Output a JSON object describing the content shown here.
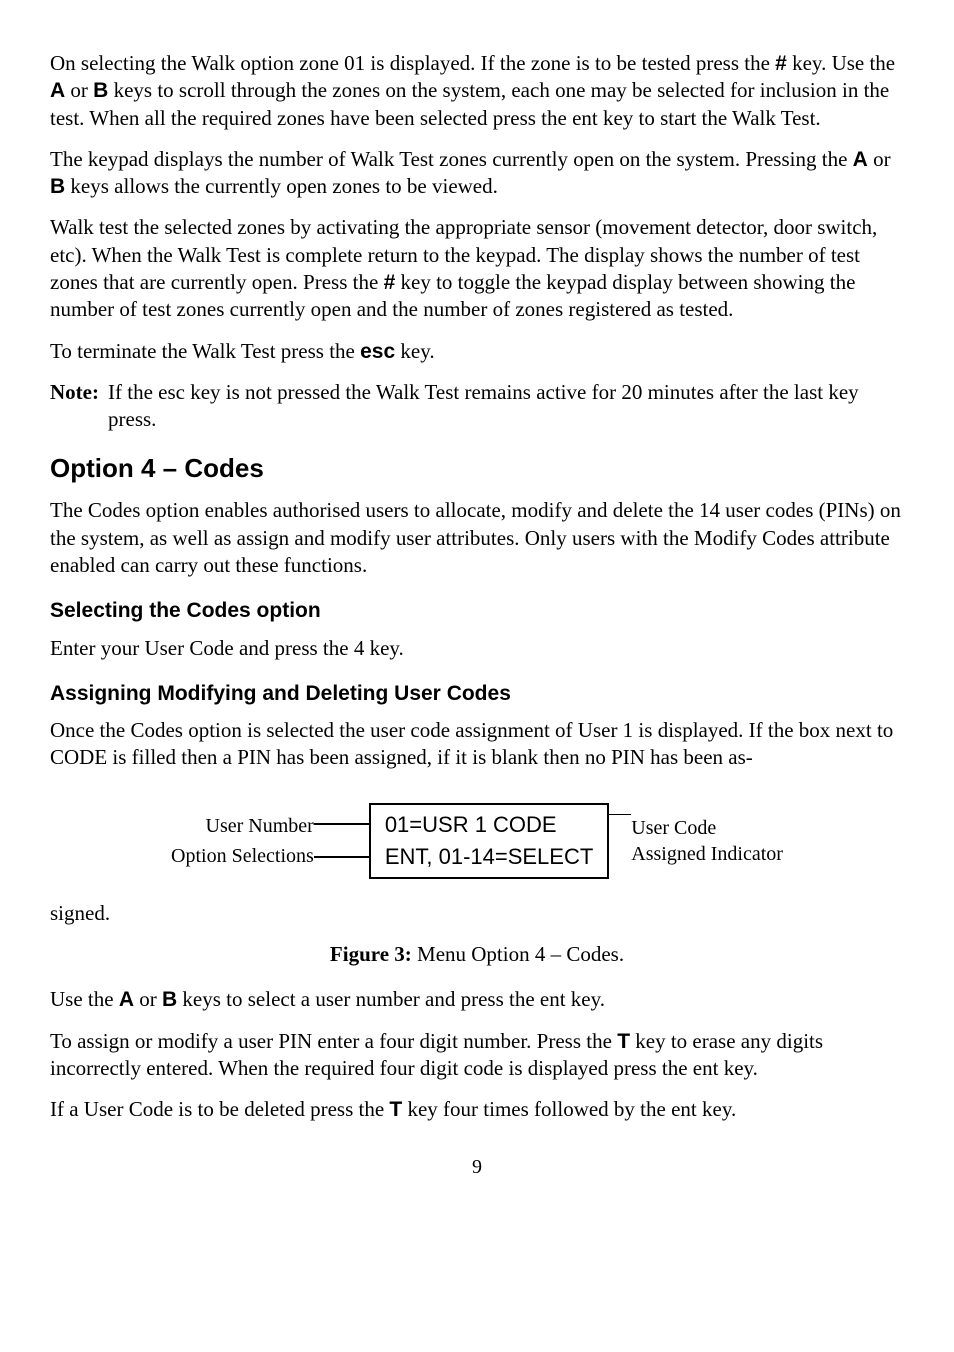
{
  "p1_a": "On selecting the Walk option zone 01 is displayed. If the zone is to be tested press the ",
  "p1_hash": "#",
  "p1_b": " key. Use the ",
  "p1_A": "A",
  "p1_c": " or ",
  "p1_B": "B",
  "p1_d": " keys to scroll through the zones on the system, each one may be selected for inclusion in the test. When all the required zones have been selected press the ent key to start the Walk Test.",
  "p2_a": "The keypad displays the number of Walk Test zones currently open on the system. Pressing the ",
  "p2_A": "A",
  "p2_b": " or ",
  "p2_B": "B",
  "p2_c": " keys allows the currently open zones to be viewed.",
  "p3_a": "Walk test the selected zones by activating the appropriate sensor (movement detector, door switch, etc). When the Walk Test is complete return to the keypad. The display shows the number of test zones that are currently open. Press the ",
  "p3_hash": "#",
  "p3_b": " key to toggle the keypad display between showing the number of test zones currently open and the number of zones registered as tested.",
  "p4_a": "To terminate the Walk Test press the ",
  "p4_esc": "esc",
  "p4_b": " key.",
  "note_label": "Note:",
  "note_text": "If the esc key is not pressed the Walk Test remains active for 20 minutes after the last key press.",
  "h2": "Option 4 – Codes",
  "p5": "The Codes option enables authorised users to allocate, modify and delete the 14 user codes (PINs) on the system, as well as assign and modify user attributes. Only users with the Modify Codes attribute enabled can carry out these functions.",
  "h3a": "Selecting the Codes option",
  "p6": "Enter your User Code and press the 4 key.",
  "h3b": "Assigning Modifying and Deleting User Codes",
  "p7": "Once the Codes option is selected the user code assignment of User 1 is displayed. If the box next to CODE is filled then a PIN has been assigned, if it is blank then no PIN has been as-",
  "fig_left1": "User Number",
  "fig_left2": "Option Selections",
  "fig_lcd1": "01=USR 1  CODE",
  "fig_lcd2": "ENT, 01-14=SELECT",
  "fig_right1": "User Code",
  "fig_right2": "Assigned Indicator",
  "p_signed": "signed.",
  "fig_caption_bold": "Figure 3:",
  "fig_caption_rest": " Menu Option 4 – Codes.",
  "p8_a": "Use the ",
  "p8_A": "A",
  "p8_b": " or ",
  "p8_B": "B",
  "p8_c": " keys to select a user number and press the ent key.",
  "p9_a": "To assign or modify a user PIN enter a four digit number. Press the ",
  "p9_star": "T",
  "p9_b": " key to erase any digits incorrectly entered. When the required four digit code is displayed press the ent key.",
  "p10_a": "If a User Code is to be deleted press the ",
  "p10_star": "T",
  "p10_b": " key four times followed by the ent key.",
  "page_num": "9"
}
